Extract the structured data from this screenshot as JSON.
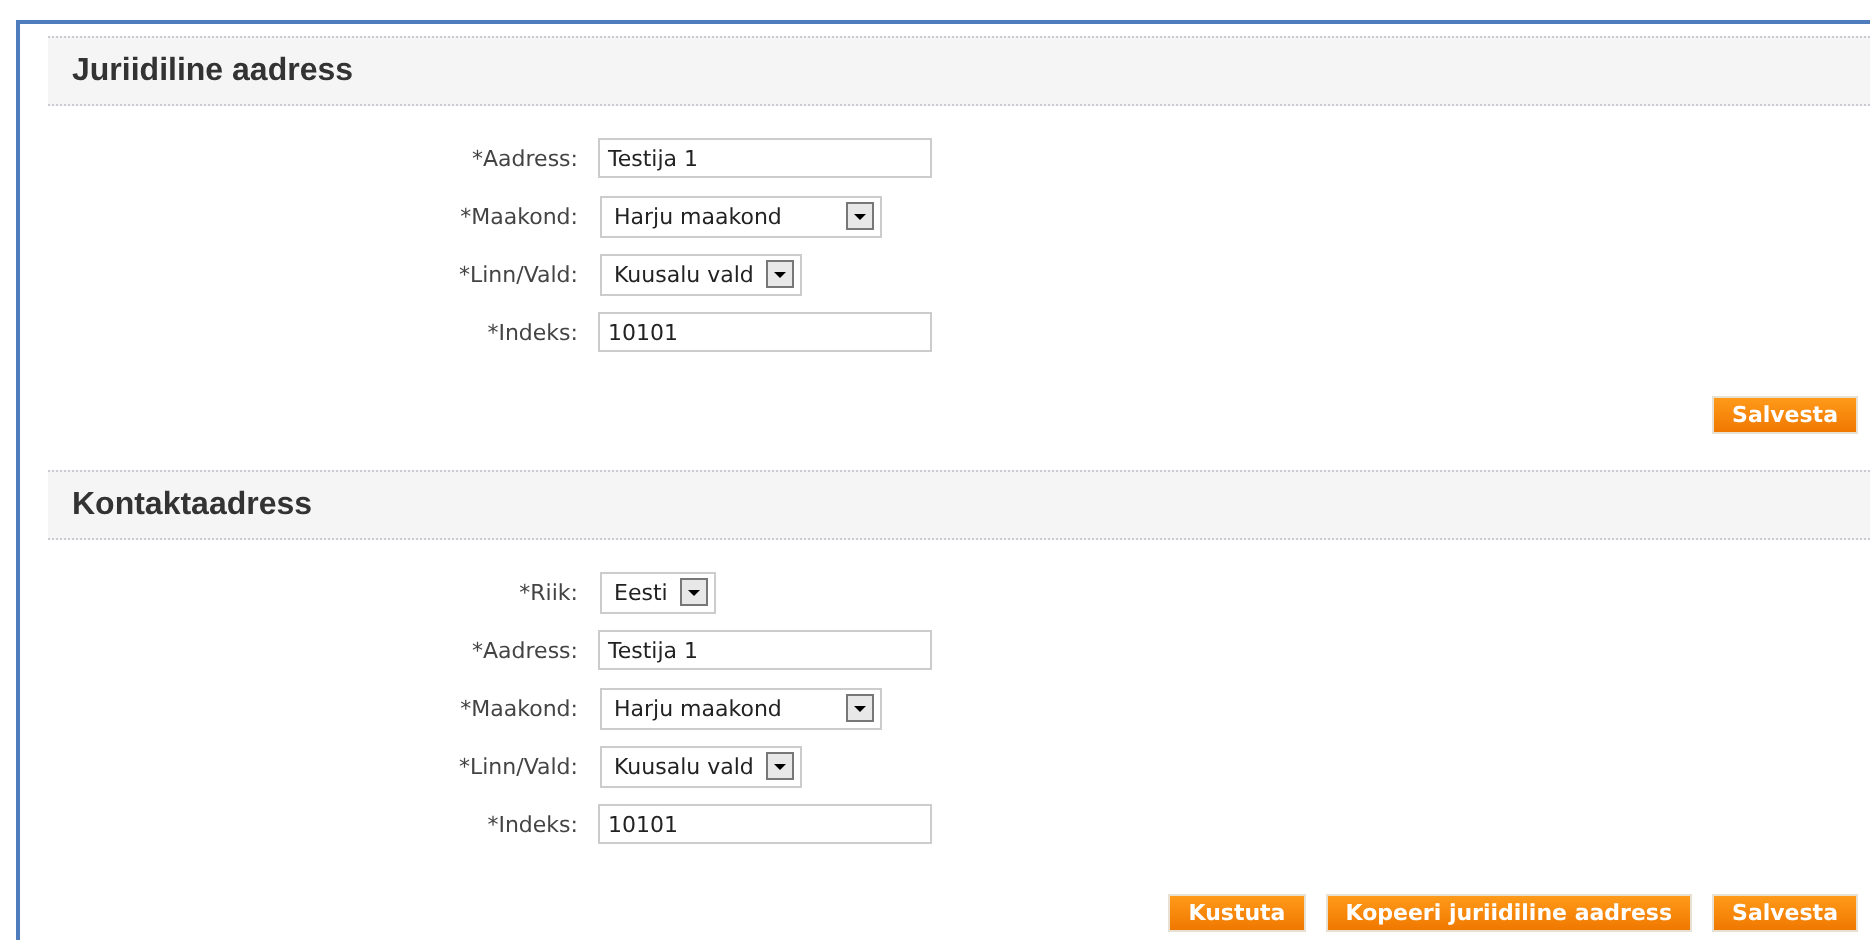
{
  "sections": [
    {
      "title": "Juriidiline aadress",
      "fields": [
        {
          "label": "*Aadress:",
          "kind": "text",
          "value": "Testija 1"
        },
        {
          "label": "*Maakond:",
          "kind": "select",
          "value": "Harju maakond"
        },
        {
          "label": "*Linn/Vald:",
          "kind": "select",
          "value": "Kuusalu vald"
        },
        {
          "label": "*Indeks:",
          "kind": "text",
          "value": "10101"
        }
      ],
      "buttons": [
        "Salvesta"
      ]
    },
    {
      "title": "Kontaktaadress",
      "fields": [
        {
          "label": "*Riik:",
          "kind": "select",
          "value": "Eesti"
        },
        {
          "label": "*Aadress:",
          "kind": "text",
          "value": "Testija 1"
        },
        {
          "label": "*Maakond:",
          "kind": "select",
          "value": "Harju maakond"
        },
        {
          "label": "*Linn/Vald:",
          "kind": "select",
          "value": "Kuusalu vald"
        },
        {
          "label": "*Indeks:",
          "kind": "text",
          "value": "10101"
        }
      ],
      "buttons": [
        "Kustuta",
        "Kopeeri juriidiline aadress",
        "Salvesta"
      ]
    }
  ]
}
